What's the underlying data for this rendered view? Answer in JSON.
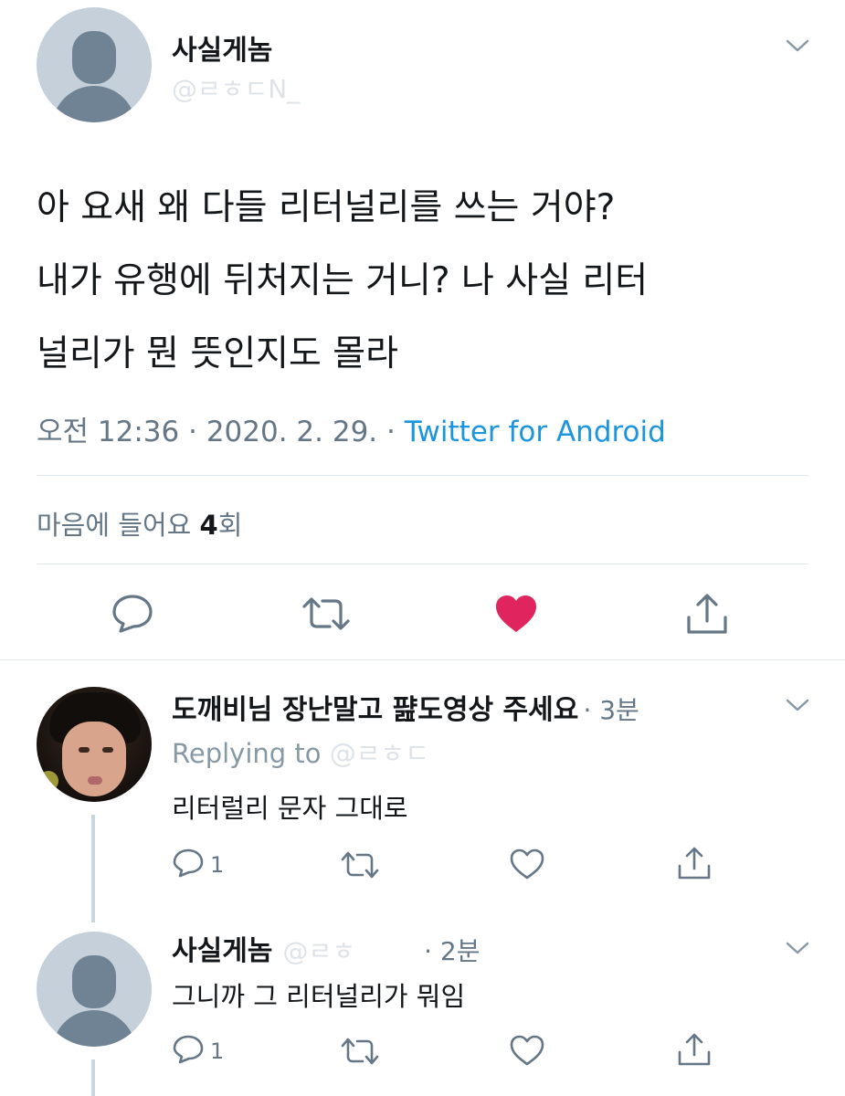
{
  "main_tweet": {
    "author_name": "사실게놈",
    "author_handle": "@ㄹㅎㄷN_",
    "text_lines": [
      "아 요새 왜 다들 리터널리를 쓰는 거야?",
      "내가 유행에 뒤처지는 거니? 나 사실 리터",
      "널리가 뭔 뜻인지도 몰라"
    ],
    "time": "오전 12:36",
    "separator": "·",
    "date": "2020. 2. 29.",
    "source": "Twitter for Android",
    "likes_label": "마음에 들어요",
    "likes_count": "4",
    "likes_unit": "회"
  },
  "replies": [
    {
      "author_name": "도깨비님 장난말고 퍒도영상 주세요",
      "time": "· 3분",
      "replying_to_label": "Replying to",
      "replying_to_handle": "@ㄹㅎㄷ",
      "text": "리터럴리 문자 그대로",
      "reply_count": "1"
    },
    {
      "author_name": "사실게놈",
      "author_handle": "@ㄹㅎ",
      "time": "· 2분",
      "text": "그니까 그 리터널리가 뭐임",
      "reply_count": "1"
    }
  ],
  "colors": {
    "like_active": "#e0245e",
    "link": "#1b95e0",
    "muted": "#657786",
    "icon": "#657786"
  }
}
